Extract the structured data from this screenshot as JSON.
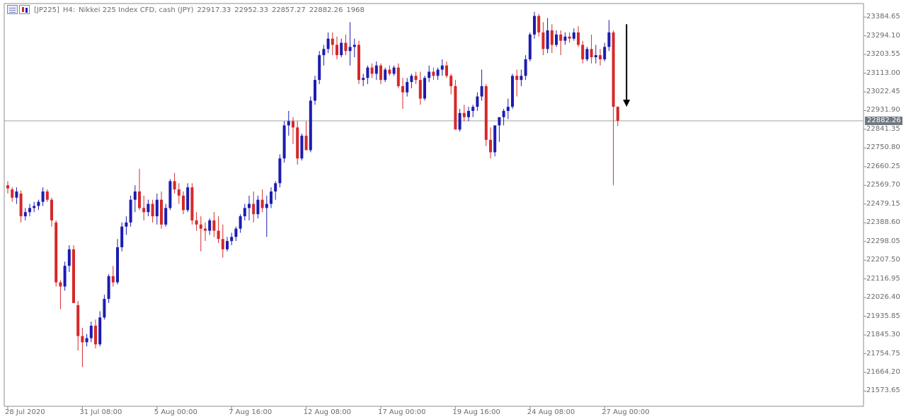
{
  "header": {
    "symbol": "[JP225]",
    "timeframe": "H4:",
    "description": "Nikkei 225 Index CFD, cash (JPY)",
    "open": "22917.33",
    "high": "22952.33",
    "low": "22857.27",
    "close": "22882.26",
    "extra": "1968"
  },
  "icons": [
    "grid-icon",
    "bars-icon"
  ],
  "colors": {
    "bull": "#1c1cb0",
    "bear": "#d62828",
    "axis": "#6b6b6b",
    "price_line": "#a0a0a0",
    "arrow": "#000000"
  },
  "chart_data": {
    "type": "candlestick",
    "ylim": [
      21500,
      23450
    ],
    "current_price": 22882.26,
    "current_price_label": "22882.26",
    "y_ticks": [
      "23384.65",
      "23294.10",
      "23203.55",
      "23113.00",
      "23022.45",
      "22931.90",
      "22841.35",
      "22750.80",
      "22660.25",
      "22569.70",
      "22479.15",
      "22388.60",
      "22298.05",
      "22207.50",
      "22116.95",
      "22026.40",
      "21935.85",
      "21845.30",
      "21754.75",
      "21664.20",
      "21573.65"
    ],
    "x_ticks": [
      {
        "label": "28 Jul 2020",
        "index": 0
      },
      {
        "label": "31 Jul 08:00",
        "index": 17
      },
      {
        "label": "5 Aug 00:00",
        "index": 34
      },
      {
        "label": "7 Aug 16:00",
        "index": 51
      },
      {
        "label": "12 Aug 08:00",
        "index": 68
      },
      {
        "label": "17 Aug 00:00",
        "index": 85
      },
      {
        "label": "19 Aug 16:00",
        "index": 102
      },
      {
        "label": "24 Aug 08:00",
        "index": 119
      },
      {
        "label": "27 Aug 00:00",
        "index": 136
      }
    ],
    "candles": [
      [
        22570,
        22590,
        22530,
        22555
      ],
      [
        22550,
        22560,
        22490,
        22510
      ],
      [
        22510,
        22560,
        22480,
        22540
      ],
      [
        22530,
        22545,
        22390,
        22420
      ],
      [
        22420,
        22460,
        22400,
        22440
      ],
      [
        22440,
        22480,
        22420,
        22460
      ],
      [
        22460,
        22490,
        22440,
        22470
      ],
      [
        22470,
        22500,
        22450,
        22490
      ],
      [
        22490,
        22560,
        22470,
        22540
      ],
      [
        22540,
        22550,
        22490,
        22500
      ],
      [
        22500,
        22510,
        22370,
        22400
      ],
      [
        22390,
        22400,
        22080,
        22100
      ],
      [
        22100,
        22110,
        21970,
        22080
      ],
      [
        22080,
        22200,
        22060,
        22180
      ],
      [
        22180,
        22280,
        22150,
        22260
      ],
      [
        22260,
        22280,
        22000,
        22000
      ],
      [
        21990,
        22010,
        21770,
        21840
      ],
      [
        21840,
        21880,
        21690,
        21810
      ],
      [
        21810,
        21850,
        21790,
        21830
      ],
      [
        21830,
        21910,
        21810,
        21890
      ],
      [
        21890,
        21920,
        21780,
        21800
      ],
      [
        21800,
        21960,
        21790,
        21930
      ],
      [
        21930,
        22040,
        21920,
        22020
      ],
      [
        22020,
        22140,
        22000,
        22130
      ],
      [
        22130,
        22180,
        22080,
        22100
      ],
      [
        22100,
        22310,
        22090,
        22270
      ],
      [
        22270,
        22390,
        22250,
        22370
      ],
      [
        22370,
        22420,
        22330,
        22390
      ],
      [
        22390,
        22520,
        22370,
        22500
      ],
      [
        22500,
        22570,
        22440,
        22540
      ],
      [
        22540,
        22650,
        22450,
        22460
      ],
      [
        22460,
        22520,
        22400,
        22440
      ],
      [
        22440,
        22500,
        22420,
        22480
      ],
      [
        22480,
        22500,
        22390,
        22420
      ],
      [
        22420,
        22530,
        22380,
        22500
      ],
      [
        22500,
        22540,
        22360,
        22380
      ],
      [
        22380,
        22480,
        22370,
        22460
      ],
      [
        22460,
        22600,
        22450,
        22590
      ],
      [
        22590,
        22630,
        22530,
        22550
      ],
      [
        22550,
        22580,
        22480,
        22520
      ],
      [
        22520,
        22540,
        22430,
        22450
      ],
      [
        22450,
        22580,
        22440,
        22560
      ],
      [
        22560,
        22580,
        22380,
        22400
      ],
      [
        22400,
        22440,
        22350,
        22380
      ],
      [
        22380,
        22420,
        22250,
        22360
      ],
      [
        22360,
        22390,
        22300,
        22350
      ],
      [
        22350,
        22410,
        22330,
        22400
      ],
      [
        22400,
        22440,
        22320,
        22350
      ],
      [
        22350,
        22420,
        22290,
        22310
      ],
      [
        22310,
        22380,
        22220,
        22260
      ],
      [
        22260,
        22320,
        22250,
        22300
      ],
      [
        22300,
        22340,
        22280,
        22320
      ],
      [
        22320,
        22370,
        22300,
        22360
      ],
      [
        22360,
        22430,
        22340,
        22420
      ],
      [
        22420,
        22480,
        22400,
        22460
      ],
      [
        22460,
        22520,
        22400,
        22480
      ],
      [
        22480,
        22540,
        22390,
        22430
      ],
      [
        22430,
        22520,
        22410,
        22500
      ],
      [
        22500,
        22550,
        22440,
        22460
      ],
      [
        22460,
        22520,
        22320,
        22480
      ],
      [
        22480,
        22560,
        22460,
        22540
      ],
      [
        22540,
        22590,
        22500,
        22580
      ],
      [
        22580,
        22720,
        22560,
        22700
      ],
      [
        22700,
        22880,
        22680,
        22860
      ],
      [
        22860,
        22930,
        22810,
        22880
      ],
      [
        22880,
        22900,
        22770,
        22850
      ],
      [
        22850,
        22880,
        22670,
        22700
      ],
      [
        22700,
        22820,
        22690,
        22810
      ],
      [
        22810,
        22880,
        22740,
        22740
      ],
      [
        22740,
        23000,
        22730,
        22980
      ],
      [
        22980,
        23100,
        22960,
        23080
      ],
      [
        23080,
        23220,
        23060,
        23200
      ],
      [
        23200,
        23250,
        23150,
        23230
      ],
      [
        23230,
        23310,
        23210,
        23280
      ],
      [
        23280,
        23310,
        23200,
        23250
      ],
      [
        23250,
        23290,
        23180,
        23200
      ],
      [
        23200,
        23280,
        23190,
        23260
      ],
      [
        23260,
        23300,
        23200,
        23220
      ],
      [
        23220,
        23360,
        23150,
        23240
      ],
      [
        23240,
        23280,
        23190,
        23250
      ],
      [
        23250,
        23270,
        23060,
        23080
      ],
      [
        23080,
        23110,
        23050,
        23090
      ],
      [
        23090,
        23150,
        23060,
        23140
      ],
      [
        23140,
        23160,
        23090,
        23110
      ],
      [
        23110,
        23170,
        23080,
        23150
      ],
      [
        23150,
        23160,
        23060,
        23080
      ],
      [
        23080,
        23140,
        23070,
        23130
      ],
      [
        23130,
        23150,
        23100,
        23110
      ],
      [
        23110,
        23150,
        23100,
        23140
      ],
      [
        23140,
        23160,
        23040,
        23050
      ],
      [
        23050,
        23090,
        22940,
        23020
      ],
      [
        23020,
        23090,
        23000,
        23070
      ],
      [
        23070,
        23110,
        23040,
        23100
      ],
      [
        23100,
        23120,
        23060,
        23080
      ],
      [
        23080,
        23120,
        22960,
        22990
      ],
      [
        22990,
        23100,
        22980,
        23090
      ],
      [
        23090,
        23150,
        23070,
        23120
      ],
      [
        23120,
        23140,
        23080,
        23100
      ],
      [
        23100,
        23140,
        23080,
        23130
      ],
      [
        23130,
        23180,
        23100,
        23150
      ],
      [
        23150,
        23170,
        23090,
        23100
      ],
      [
        23100,
        23110,
        23010,
        23050
      ],
      [
        23050,
        23080,
        22840,
        22840
      ],
      [
        22840,
        22940,
        22830,
        22920
      ],
      [
        22920,
        22960,
        22880,
        22900
      ],
      [
        22900,
        22950,
        22880,
        22930
      ],
      [
        22930,
        22960,
        22900,
        22950
      ],
      [
        22950,
        23020,
        22930,
        23000
      ],
      [
        23000,
        23130,
        22980,
        23050
      ],
      [
        23050,
        23060,
        22760,
        22790
      ],
      [
        22790,
        22850,
        22700,
        22730
      ],
      [
        22730,
        22860,
        22710,
        22860
      ],
      [
        22860,
        22880,
        22780,
        22900
      ],
      [
        22900,
        22940,
        22860,
        22930
      ],
      [
        22930,
        22990,
        22890,
        22950
      ],
      [
        22950,
        23110,
        22940,
        23100
      ],
      [
        23100,
        23130,
        23000,
        23080
      ],
      [
        23080,
        23130,
        23050,
        23100
      ],
      [
        23100,
        23200,
        23080,
        23180
      ],
      [
        23180,
        23310,
        23170,
        23300
      ],
      [
        23300,
        23410,
        23280,
        23390
      ],
      [
        23390,
        23400,
        23290,
        23310
      ],
      [
        23310,
        23360,
        23200,
        23230
      ],
      [
        23230,
        23380,
        23210,
        23320
      ],
      [
        23320,
        23350,
        23210,
        23250
      ],
      [
        23250,
        23320,
        23240,
        23300
      ],
      [
        23300,
        23320,
        23200,
        23270
      ],
      [
        23270,
        23310,
        23250,
        23290
      ],
      [
        23290,
        23310,
        23260,
        23280
      ],
      [
        23280,
        23330,
        23270,
        23310
      ],
      [
        23310,
        23340,
        23240,
        23250
      ],
      [
        23250,
        23270,
        23160,
        23180
      ],
      [
        23180,
        23240,
        23170,
        23230
      ],
      [
        23230,
        23300,
        23160,
        23190
      ],
      [
        23190,
        23250,
        23160,
        23200
      ],
      [
        23200,
        23230,
        23150,
        23180
      ],
      [
        23180,
        23260,
        23170,
        23240
      ],
      [
        23240,
        23370,
        23220,
        23310
      ],
      [
        23310,
        23320,
        22570,
        22950
      ],
      [
        22950,
        22952,
        22857,
        22882
      ]
    ],
    "annotation": {
      "type": "arrow-down",
      "from": 23350,
      "to": 22950,
      "index": 141
    }
  }
}
